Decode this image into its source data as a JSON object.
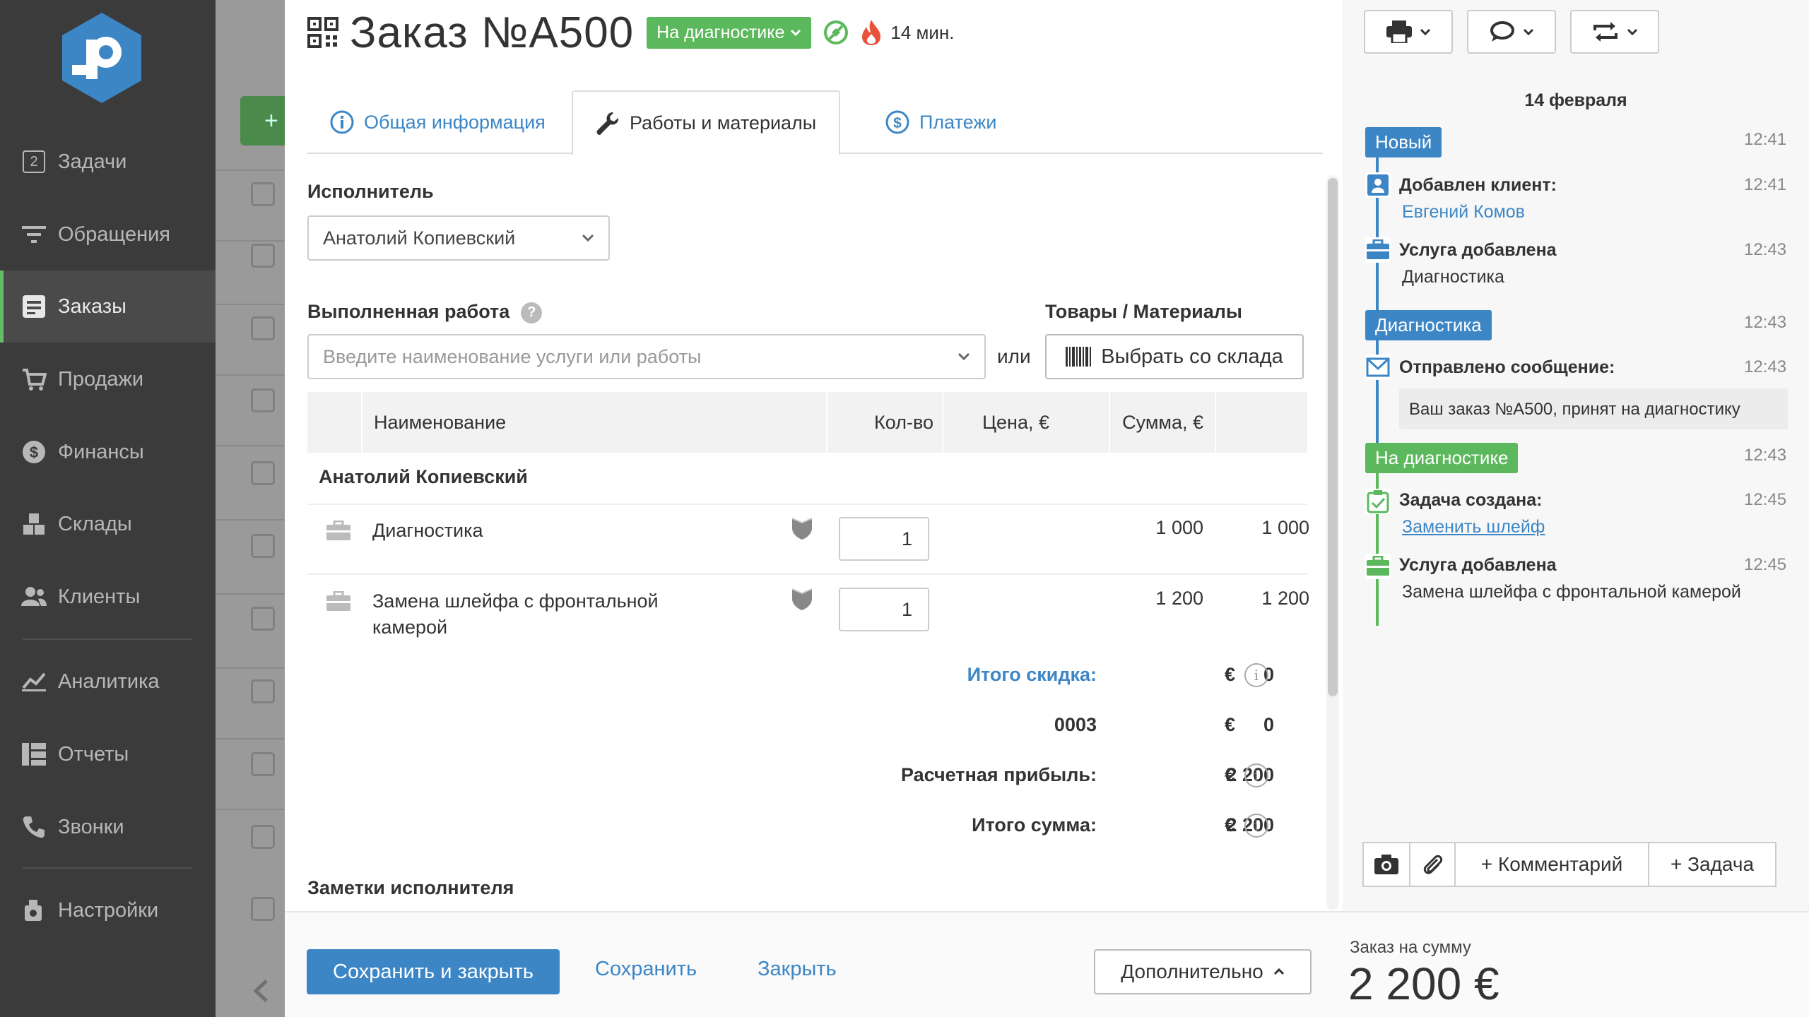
{
  "sidebar": {
    "items": [
      {
        "label": "Задачи",
        "icon": "tasks-icon",
        "badge": "2"
      },
      {
        "label": "Обращения",
        "icon": "filter-icon"
      },
      {
        "label": "Заказы",
        "icon": "orders-icon",
        "active": true
      },
      {
        "label": "Продажи",
        "icon": "cart-icon"
      },
      {
        "label": "Финансы",
        "icon": "dollar-icon"
      },
      {
        "label": "Склады",
        "icon": "boxes-icon"
      },
      {
        "label": "Клиенты",
        "icon": "users-icon"
      },
      {
        "label": "Аналитика",
        "icon": "chart-icon"
      },
      {
        "label": "Отчеты",
        "icon": "table-icon"
      },
      {
        "label": "Звонки",
        "icon": "phone-icon"
      },
      {
        "label": "Настройки",
        "icon": "settings-icon"
      }
    ]
  },
  "header": {
    "title": "Заказ №A500",
    "status": "На диагностике",
    "timer": "14 мин."
  },
  "tabs": [
    {
      "label": "Общая информация",
      "icon": "info-icon"
    },
    {
      "label": "Работы и материалы",
      "icon": "wrench-icon",
      "active": true
    },
    {
      "label": "Платежи",
      "icon": "dollar-icon"
    }
  ],
  "form": {
    "executor_label": "Исполнитель",
    "executor_value": "Анатолий Копиевский",
    "work_label": "Выполненная работа",
    "work_placeholder": "Введите наименование услуги или работы",
    "or_label": "или",
    "goods_label": "Товары / Материалы",
    "warehouse_button": "Выбрать со склада"
  },
  "table": {
    "headers": {
      "name": "Наименование",
      "qty": "Кол-во",
      "price": "Цена, €",
      "sum": "Сумма, €"
    },
    "group": "Анатолий Копиевский",
    "rows": [
      {
        "name": "Диагностика",
        "qty": "1",
        "price": "1 000",
        "sum": "1 000"
      },
      {
        "name": "Замена шлейфа с фронтальной",
        "name2": "камерой",
        "qty": "1",
        "price": "1 200",
        "sum": "1 200"
      }
    ]
  },
  "summary": {
    "discount_label": "Итого скидка:",
    "discount_value": "0",
    "code_label": "0003",
    "code_value": "0",
    "profit_label": "Расчетная прибыль:",
    "profit_value": "2 200",
    "total_label": "Итого сумма:",
    "total_value": "2 200",
    "currency": "€"
  },
  "notes_label": "Заметки исполнителя",
  "footer": {
    "save_close": "Сохранить и закрыть",
    "save": "Сохранить",
    "close": "Закрыть",
    "more": "Дополнительно",
    "total_caption": "Заказ на сумму",
    "total_value": "2 200 €"
  },
  "timeline": {
    "date": "14 февраля",
    "events": [
      {
        "type": "status",
        "label": "Новый",
        "time": "12:41",
        "color": "#3d86c6"
      },
      {
        "type": "event",
        "icon": "client-icon",
        "title": "Добавлен клиент:",
        "sub": "Евгений Комов",
        "time": "12:41"
      },
      {
        "type": "event",
        "icon": "briefcase-icon",
        "title": "Услуга добавлена",
        "sub": "Диагностика",
        "time": "12:43"
      },
      {
        "type": "status",
        "label": "Диагностика",
        "time": "12:43",
        "color": "#3d86c6"
      },
      {
        "type": "event",
        "icon": "mail-icon",
        "title": "Отправлено сообщение:",
        "sub": "Ваш заказ №A500, принят на диагностику",
        "time": "12:43"
      },
      {
        "type": "status",
        "label": "На диагностике",
        "time": "12:43",
        "color": "#5cb85c"
      },
      {
        "type": "event",
        "icon": "task-icon",
        "title": "Задача создана:",
        "sub": "Заменить шлейф",
        "time": "12:45"
      },
      {
        "type": "event",
        "icon": "briefcase-icon",
        "title": "Услуга добавлена",
        "sub": "Замена шлейфа с фронтальной камерой",
        "time": "12:45"
      }
    ],
    "comment_button": "+ Комментарий",
    "task_button": "+ Задача"
  },
  "colors": {
    "accent": "#3d86c6",
    "success": "#5cb85c",
    "sidebar": "#3b3b3b"
  }
}
